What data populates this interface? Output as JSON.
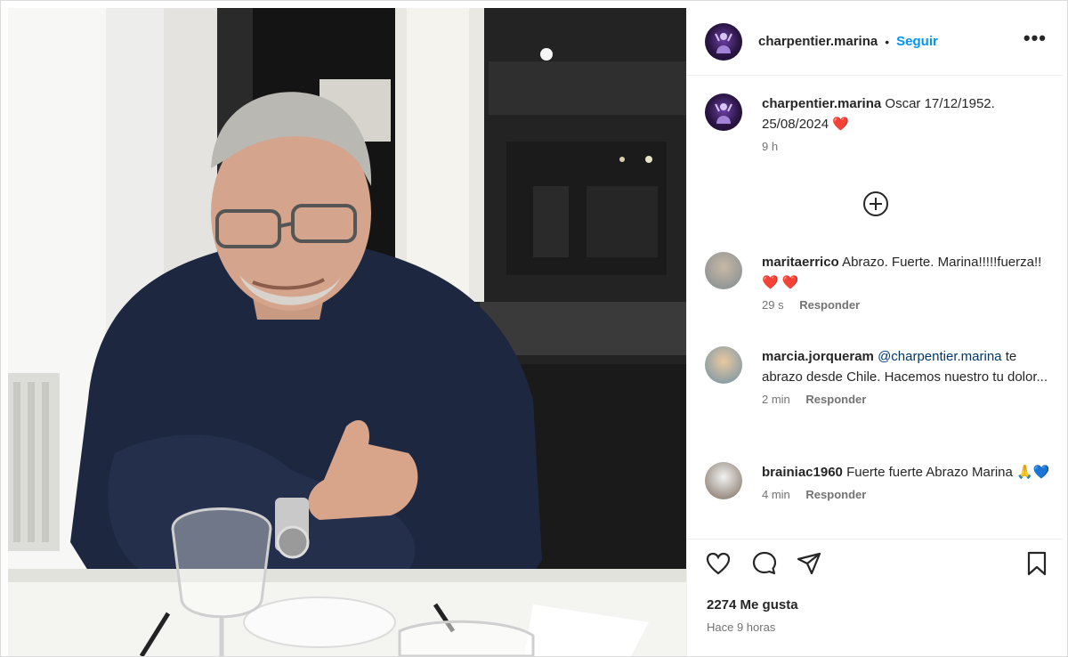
{
  "post": {
    "username": "charpentier.marina",
    "separator": "•",
    "follow_label": "Seguir",
    "more_label": "•••",
    "caption": {
      "username": "charpentier.marina",
      "text": "Oscar 17/12/1952. 25/08/2024",
      "emoji": "❤️",
      "time": "9 h"
    },
    "comments": [
      {
        "username": "maritaerrico",
        "text": "Abrazo. Fuerte. Marina!!!!!fuerza!!",
        "emoji": "❤️ ❤️",
        "time": "29 s",
        "reply": "Responder"
      },
      {
        "username": "marcia.jorqueram",
        "mention": "@charpentier.marina",
        "text": "te abrazo desde Chile. Hacemos nuestro tu dolor...",
        "time": "2 min",
        "reply": "Responder"
      },
      {
        "username": "brainiac1960",
        "text": "Fuerte fuerte Abrazo Marina",
        "emoji": "🙏💙",
        "time": "4 min",
        "reply": "Responder"
      }
    ],
    "likes": "2274 Me gusta",
    "posted_ago": "Hace 9 horas"
  },
  "colors": {
    "accent": "#0095f6",
    "text": "#262626",
    "muted": "#737373",
    "heart": "#e0201b"
  },
  "icons": {
    "like": "heart-outline-icon",
    "comment": "speech-bubble-icon",
    "share": "paper-plane-icon",
    "save": "bookmark-icon",
    "load_more": "plus-circle-icon"
  }
}
